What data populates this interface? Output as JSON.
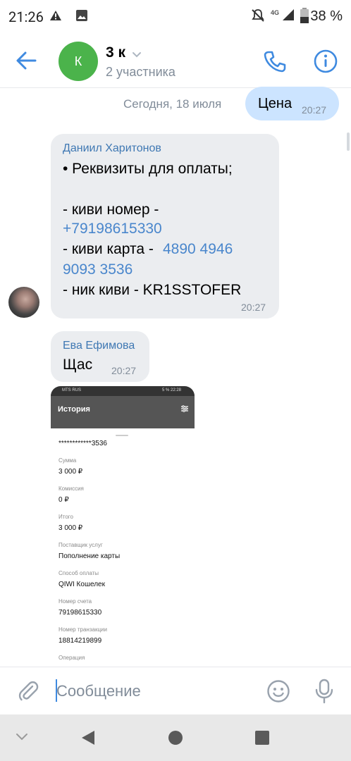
{
  "status_bar": {
    "time": "21:26",
    "network": "4G",
    "battery": "38 %"
  },
  "header": {
    "avatar_letter": "К",
    "title": "3 к",
    "subtitle": "2 участника"
  },
  "messages": {
    "date_separator": "Сегодня, 18 июля",
    "own": {
      "text": "Цена",
      "time": "20:27"
    },
    "msg1": {
      "sender": "Даниил Харитонов",
      "line1": "• Реквизиты для оплаты;",
      "line2": "- киви номер -",
      "phone": "+79198615330",
      "card_prefix": "- киви карта -",
      "card_part1": "4890 4946",
      "card_part2": "9093 3536",
      "nick": "- ник киви - KR1SSTOFER",
      "time": "20:27"
    },
    "msg2": {
      "sender": "Ева Ефимова",
      "text": "Щас",
      "time": "20:27"
    }
  },
  "attachment": {
    "status_left": "MTS RUS",
    "status_right": "5 % 22:28",
    "title": "История",
    "card_number": "************3536",
    "fields": [
      {
        "label": "Сумма",
        "value": "3 000 ₽"
      },
      {
        "label": "Комиссия",
        "value": "0 ₽"
      },
      {
        "label": "Итого",
        "value": "3 000 ₽"
      },
      {
        "label": "Поставщик услуг",
        "value": "Пополнение карты"
      },
      {
        "label": "Способ оплаты",
        "value": "QIWI Кошелек"
      },
      {
        "label": "Номер счета",
        "value": "79198615330"
      },
      {
        "label": "Номер транзакции",
        "value": "18814219899"
      },
      {
        "label": "Операция",
        "value": ""
      }
    ]
  },
  "composer": {
    "placeholder": "Сообщение"
  },
  "colors": {
    "accent": "#3f8ae0",
    "own_bubble": "#cce4ff",
    "incoming_bubble": "#ebedf0",
    "avatar_green": "#4bb34b",
    "sender_name": "#3f78b3",
    "link": "#4986cc"
  },
  "icons": [
    "warning-icon",
    "image-icon",
    "mute-icon",
    "signal-icon",
    "battery-icon",
    "back-arrow-icon",
    "chevron-down-icon",
    "phone-icon",
    "info-icon",
    "paperclip-icon",
    "emoji-icon",
    "microphone-icon",
    "nav-down-icon",
    "nav-back-icon",
    "nav-home-icon",
    "nav-recents-icon",
    "filter-icon"
  ]
}
